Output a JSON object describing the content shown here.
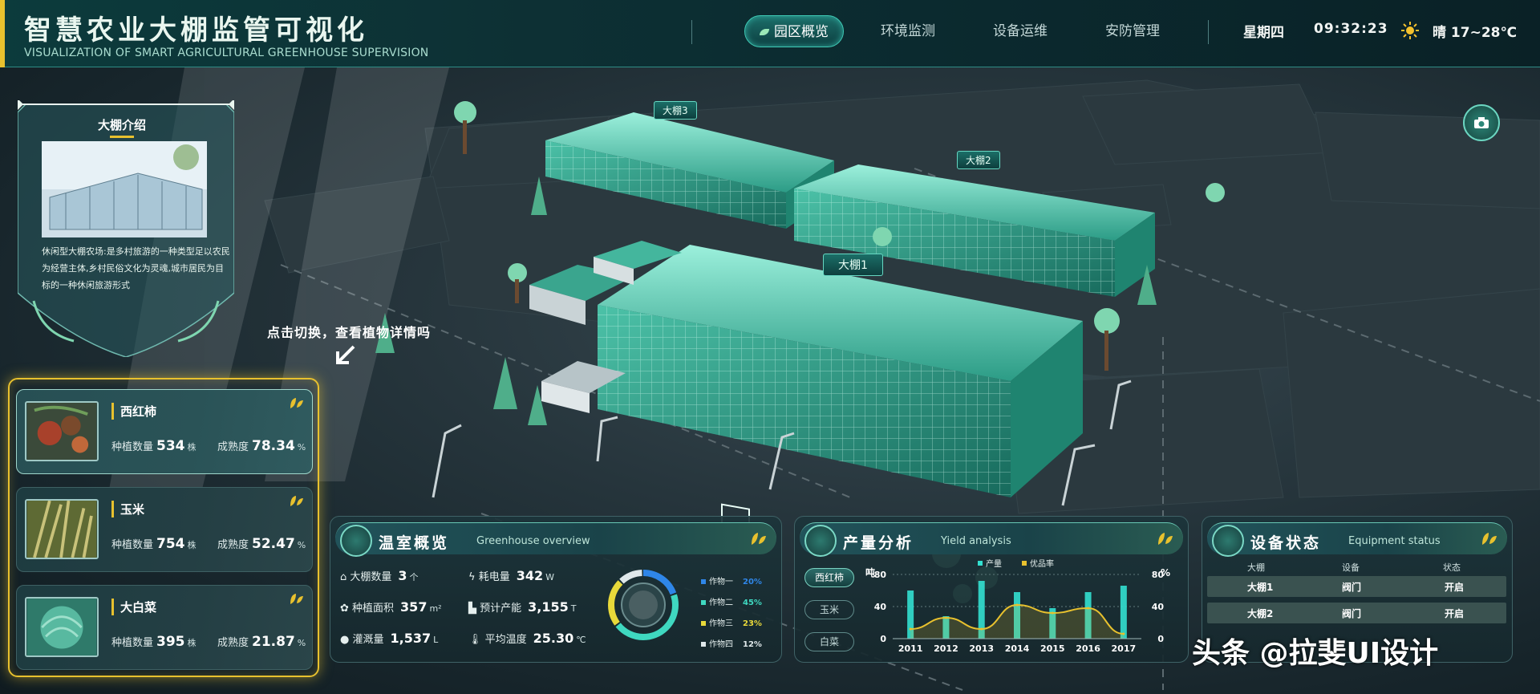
{
  "header": {
    "title_cn": "智慧农业大棚监管可视化",
    "title_en": "VISUALIZATION OF SMART AGRICULTURAL GREENHOUSE SUPERVISION",
    "nav": [
      "园区概览",
      "环境监测",
      "设备运维",
      "安防管理"
    ],
    "active_nav": "园区概览",
    "weekday": "星期四",
    "time": "09:32:23",
    "weather": "晴 17~28℃",
    "weather_icon": "sun-icon"
  },
  "scene": {
    "greenhouse_labels": [
      "大棚3",
      "大棚2",
      "大棚1"
    ],
    "camera_icon": "camera-icon"
  },
  "intro": {
    "title": "大棚介绍",
    "text": "休闲型大棚农场:是多村旅游的一种类型足以农民为经营主体,乡村民俗文化为灵魂,城市居民为目标的一种休闲旅游形式"
  },
  "hint": "点击切换，查看植物详情吗",
  "crops": [
    {
      "name": "西红柿",
      "planted_label": "种植数量",
      "planted": "534",
      "planted_unit": "株",
      "maturity_label": "成熟度",
      "maturity": "78.34",
      "maturity_unit": "%",
      "image_color": "#7a4a2c"
    },
    {
      "name": "玉米",
      "planted_label": "种植数量",
      "planted": "754",
      "planted_unit": "株",
      "maturity_label": "成熟度",
      "maturity": "52.47",
      "maturity_unit": "%",
      "image_color": "#8a8a3a"
    },
    {
      "name": "大白菜",
      "planted_label": "种植数量",
      "planted": "395",
      "planted_unit": "株",
      "maturity_label": "成熟度",
      "maturity": "21.87",
      "maturity_unit": "%",
      "image_color": "#3a8a7a"
    }
  ],
  "overview": {
    "title": "温室概览",
    "subtitle": "Greenhouse overview",
    "items": [
      {
        "label": "大棚数量",
        "value": "3",
        "unit": "个",
        "icon": "house-icon"
      },
      {
        "label": "耗电量",
        "value": "342",
        "unit": "W",
        "icon": "lightning-icon"
      },
      {
        "label": "种植面积",
        "value": "357",
        "unit": "m²",
        "icon": "plant-icon"
      },
      {
        "label": "预计产能",
        "value": "3,155",
        "unit": "T",
        "icon": "factory-icon"
      },
      {
        "label": "灌溉量",
        "value": "1,537",
        "unit": "L",
        "icon": "drop-icon"
      },
      {
        "label": "平均温度",
        "value": "25.30",
        "unit": "℃",
        "icon": "thermometer-icon"
      }
    ],
    "crop_share": [
      {
        "name": "作物一",
        "pct": "20%",
        "value": 20,
        "color": "#2f86e8"
      },
      {
        "name": "作物二",
        "pct": "45%",
        "value": 45,
        "color": "#3fd8c0"
      },
      {
        "name": "作物三",
        "pct": "23%",
        "value": 23,
        "color": "#e8d93a"
      },
      {
        "name": "作物四",
        "pct": "12%",
        "value": 12,
        "color": "#dfe8ea"
      }
    ]
  },
  "yield": {
    "title": "产量分析",
    "subtitle": "Yield analysis",
    "tabs": [
      "西红柿",
      "玉米",
      "白菜"
    ],
    "active_tab": "西红柿",
    "legend_output": "产量",
    "legend_quality": "优品率",
    "left_unit": "吨",
    "right_unit": "%"
  },
  "chart_data": {
    "type": "bar",
    "categories": [
      "2011",
      "2012",
      "2013",
      "2014",
      "2015",
      "2016",
      "2017"
    ],
    "series": [
      {
        "name": "产量",
        "type": "bar",
        "values": [
          60,
          28,
          72,
          58,
          38,
          58,
          66
        ],
        "color": "#33e0d0"
      },
      {
        "name": "优品率",
        "type": "line",
        "values": [
          12,
          26,
          12,
          42,
          32,
          38,
          6
        ],
        "color": "#e8c12e"
      }
    ],
    "ylim_left": [
      0,
      80
    ],
    "yticks_left": [
      0,
      40,
      80
    ],
    "ylim_right": [
      0,
      80
    ],
    "yticks_right": [
      0,
      40,
      80
    ],
    "ylabel_left": "吨",
    "ylabel_right": "%",
    "legend": "top-center"
  },
  "equipment": {
    "title": "设备状态",
    "subtitle": "Equipment status",
    "columns": [
      "大棚",
      "设备",
      "状态"
    ],
    "rows": [
      [
        "大棚1",
        "阀门",
        "开启"
      ],
      [
        "大棚2",
        "阀门",
        "开启"
      ]
    ]
  },
  "watermark": "头条 @拉斐UI设计",
  "colors": {
    "accent": "#e8c12e",
    "teal": "#3fd8c0",
    "background": "#17252b"
  }
}
